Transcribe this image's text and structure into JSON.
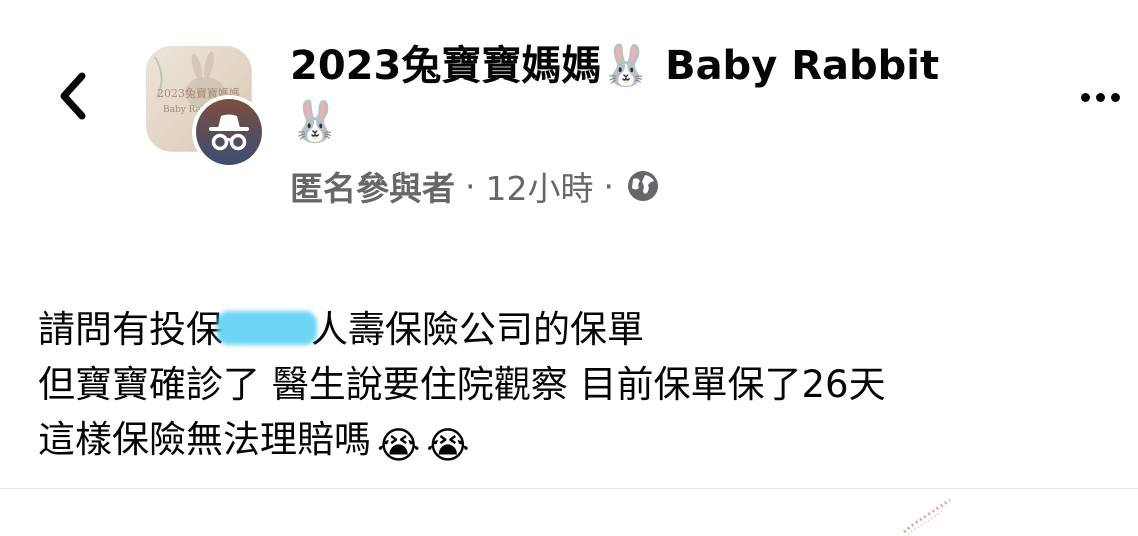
{
  "header": {
    "back_label": "<",
    "group_avatar_lines": [
      "2023兔寶寶媽媽",
      "Baby Rabbit"
    ],
    "group_name": "2023兔寶寶媽媽",
    "group_name_rabbit_1": "🐰",
    "group_name_en": "Baby Rabbit",
    "group_name_rabbit_2": "🐰",
    "author": "匿名參與者",
    "separator": "·",
    "time": "12小時",
    "privacy_icon": "globe-icon",
    "more_icon": "more-options-icon"
  },
  "post": {
    "line1_before": "請問有投保",
    "line1_after": "人壽保險公司的保單",
    "line2": "但寶寶確診了 醫生說要住院觀察 目前保單保了26天",
    "line3": "這樣保險無法理賠嗎",
    "emoji": "😭"
  },
  "colors": {
    "text": "#050505",
    "meta": "#65676b",
    "redaction": "#5fd0f3",
    "divider": "#e4e6eb"
  }
}
